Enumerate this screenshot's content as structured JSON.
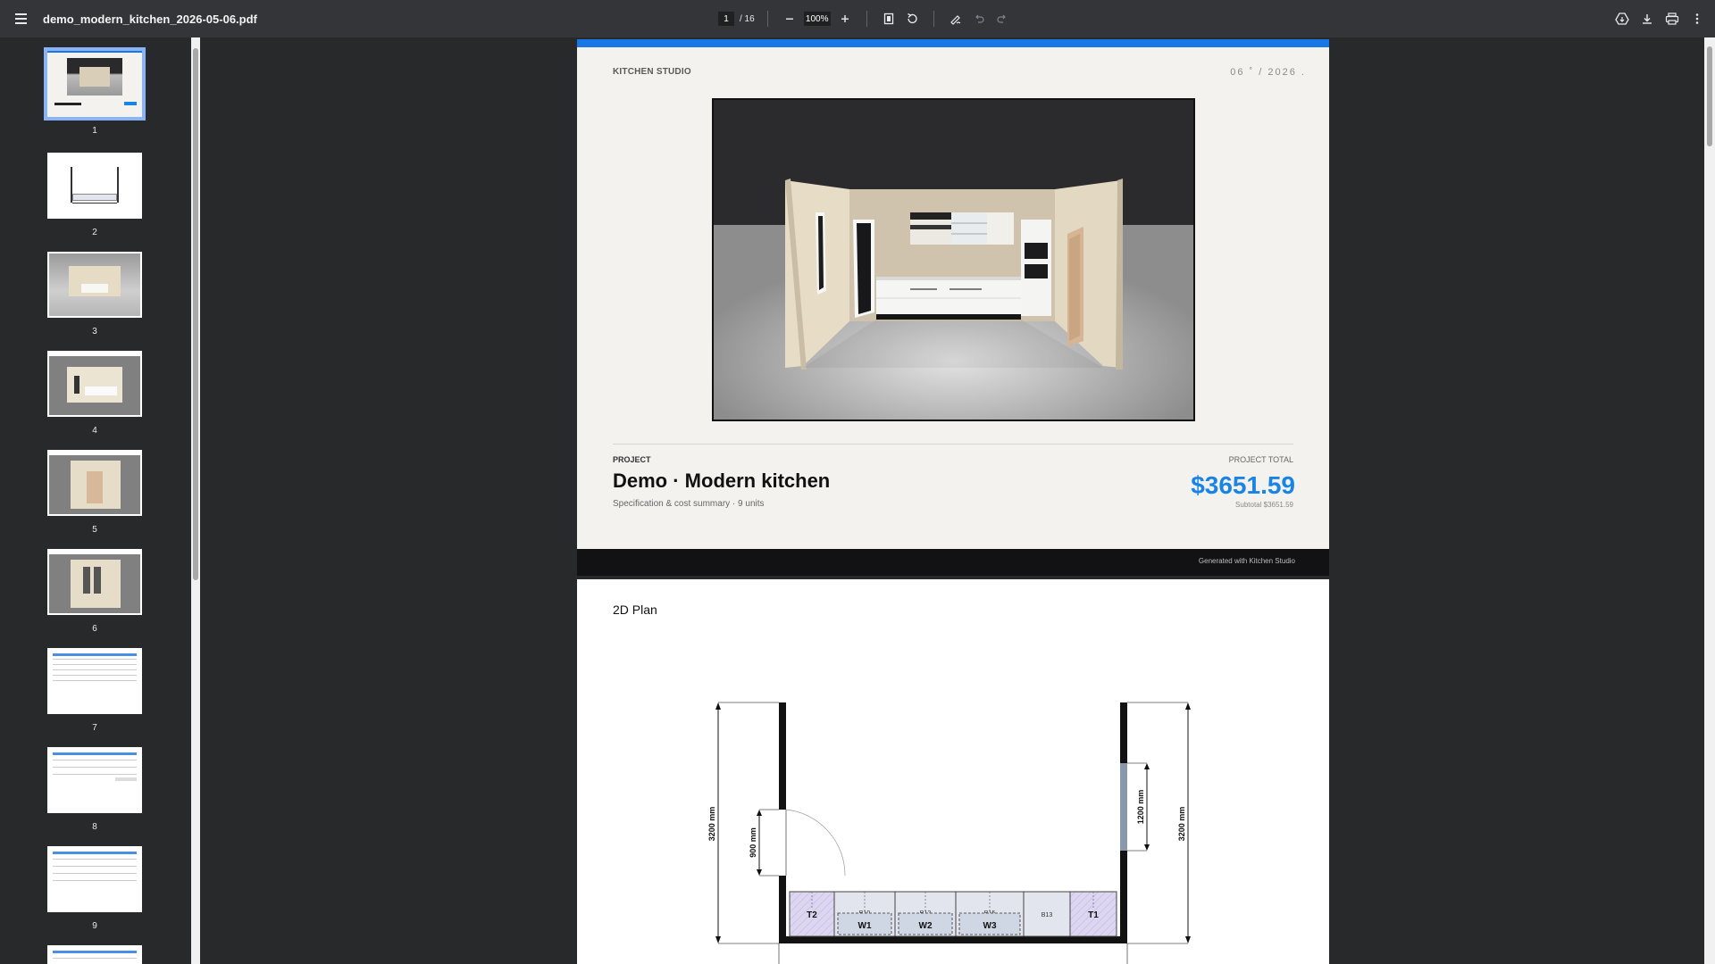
{
  "toolbar": {
    "title": "demo_modern_kitchen_2026-05-06.pdf",
    "page_current": "1",
    "page_total": "/ 16",
    "zoom": "100%"
  },
  "sidebar": {
    "thumbnails": [
      "1",
      "2",
      "3",
      "4",
      "5",
      "6",
      "7",
      "8",
      "9"
    ]
  },
  "page1": {
    "brand": "KITCHEN STUDIO",
    "date": "06 ˚   / 2026  .",
    "project_label": "PROJECT",
    "project_title": "Demo · Modern kitchen",
    "project_subtitle": "Specification & cost summary · 9 units",
    "total_label": "PROJECT TOTAL",
    "total_value": "$3651.59",
    "subtotal": "Subtotal $3651.59",
    "footer": "Generated with Kitchen Studio"
  },
  "page2": {
    "title": "2D Plan",
    "dim_left": "3200 mm",
    "dim_door": "900 mm",
    "dim_window": "1200 mm",
    "dim_right": "3200 mm",
    "units": {
      "t2": "T2",
      "w1": "W1",
      "w2": "W2",
      "w3": "W3",
      "b13": "B13",
      "t1": "T1",
      "b10": "B10",
      "b12": "B12",
      "b15": "B15"
    }
  },
  "colors": {
    "accent": "#1a84e6",
    "toolbar_bg": "#333538",
    "viewer_bg": "#28292b",
    "page_bg": "#f3f2ee",
    "tall_unit_fill": "#ddd6f0"
  }
}
